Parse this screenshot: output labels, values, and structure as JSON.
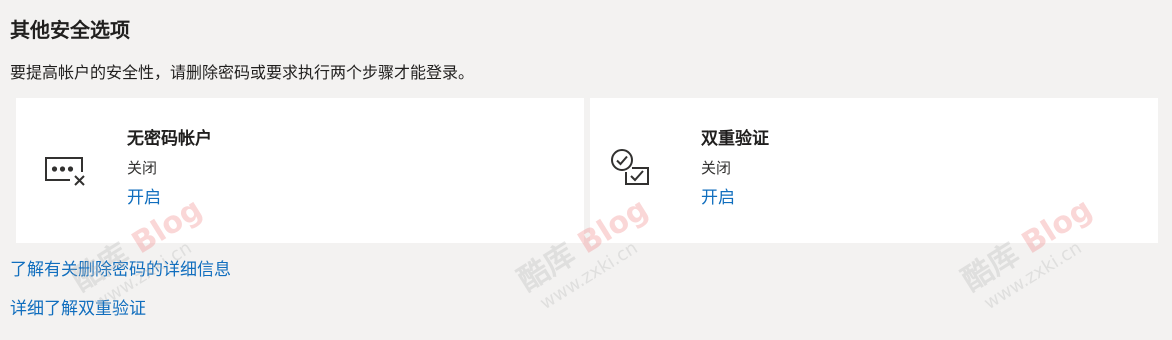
{
  "section": {
    "title": "其他安全选项",
    "description": "要提高帐户的安全性，请删除密码或要求执行两个步骤才能登录。"
  },
  "cards": [
    {
      "title": "无密码帐户",
      "status": "关闭",
      "action": "开启",
      "icon": "password-dots-x-icon"
    },
    {
      "title": "双重验证",
      "status": "关闭",
      "action": "开启",
      "icon": "two-step-verification-icon"
    }
  ],
  "links": {
    "learn_remove_password": "了解有关删除密码的详细信息",
    "learn_two_step": "详细了解双重验证"
  },
  "watermark": {
    "brand": "酷库",
    "blog": "Blog",
    "domain": "www.zxki.cn"
  },
  "colors": {
    "background": "#f3f2f1",
    "card": "#ffffff",
    "link": "#106ebe",
    "text": "#201f1e"
  }
}
